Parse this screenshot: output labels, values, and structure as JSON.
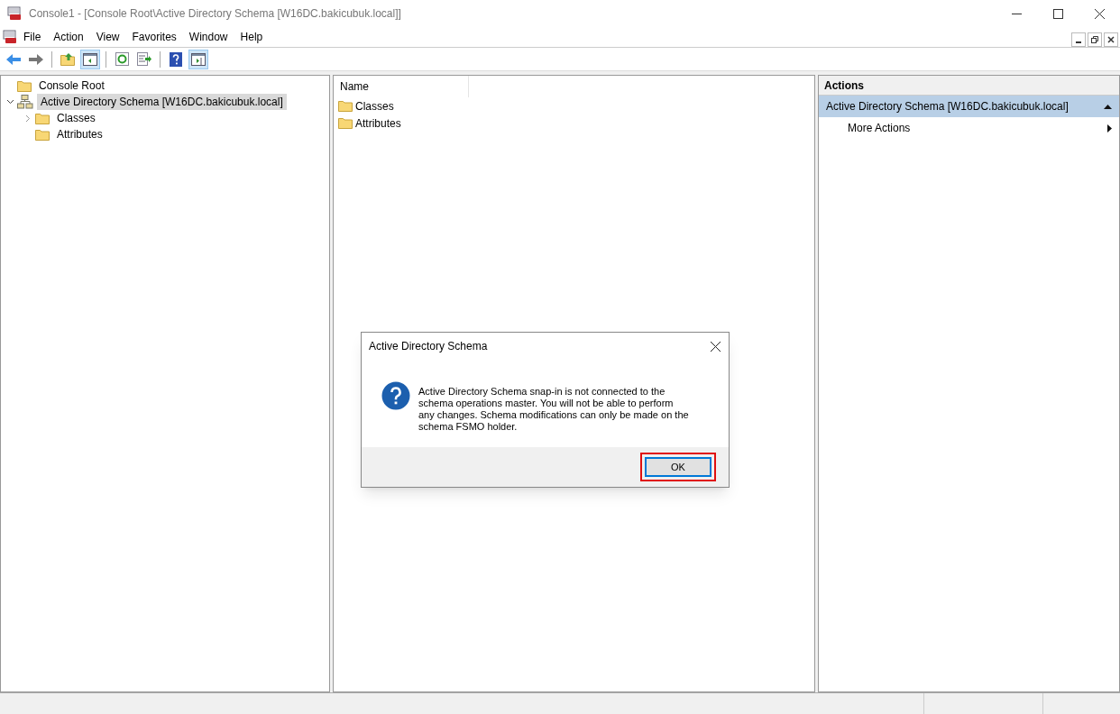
{
  "window": {
    "title": "Console1 - [Console Root\\Active Directory Schema [W16DC.bakicubuk.local]]"
  },
  "menu": [
    "File",
    "Action",
    "View",
    "Favorites",
    "Window",
    "Help"
  ],
  "toolbar": [
    [
      {
        "kind": "back"
      },
      {
        "kind": "forward"
      }
    ],
    [
      {
        "kind": "up"
      },
      {
        "kind": "tree",
        "on": true
      }
    ],
    [
      {
        "kind": "refresh"
      },
      {
        "kind": "export"
      }
    ],
    [
      {
        "kind": "help"
      },
      {
        "kind": "actionpane",
        "on": true
      }
    ]
  ],
  "tree": [
    {
      "label": "Console Root",
      "kind": "folder",
      "selected": false,
      "children": [
        {
          "label": "Active Directory Schema [W16DC.bakicubuk.local]",
          "kind": "schema",
          "selected": true,
          "expanded": true,
          "children": [
            {
              "label": "Classes",
              "kind": "folder",
              "selected": false,
              "expanded": false
            },
            {
              "label": "Attributes",
              "kind": "folder",
              "selected": false
            }
          ]
        }
      ]
    }
  ],
  "list": {
    "column": "Name",
    "items": [
      "Classes",
      "Attributes"
    ]
  },
  "actions": {
    "header": "Actions",
    "section": "Active Directory Schema [W16DC.bakicubuk.local]",
    "items": [
      "More Actions"
    ]
  },
  "dialog": {
    "title": "Active Directory Schema",
    "message": "Active Directory Schema snap-in is not connected to the schema operations master. You will not be able to perform any changes. Schema modifications can only be made on the schema FSMO holder.",
    "button": "OK",
    "highlighted": true
  }
}
